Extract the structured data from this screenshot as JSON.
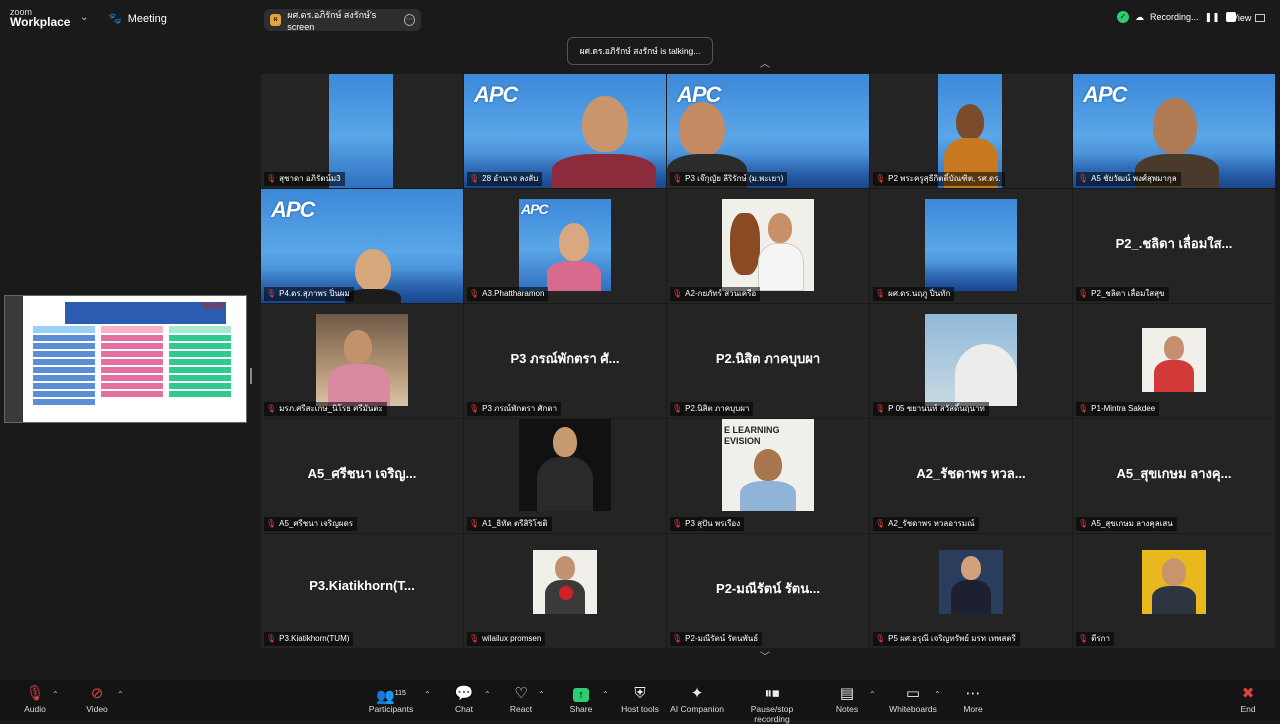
{
  "app": {
    "logo_line1": "zoom",
    "logo_line2": "Workplace",
    "meeting_label": "Meeting"
  },
  "screen_share_pill": {
    "label": "ผศ.ดร.อภิรักษ์ สงรักษ์'s screen",
    "badge": "ผ"
  },
  "recording": {
    "label": "Recording..."
  },
  "view_label": "View",
  "talking": "ผศ.ดร.อภิรักษ์ สงรักษ์ is talking...",
  "shared_screen": {
    "brand": "RUTS"
  },
  "tiles": [
    {
      "label": "สุชาดา อภิรัตน์ม3",
      "big": ""
    },
    {
      "label": "28 อำนาจ ลงลับ",
      "big": ""
    },
    {
      "label": "P3 เจ๊กุญัย ลีริรักษ์ (ม.พะเยา)",
      "big": ""
    },
    {
      "label": "P2 พระครูสุธีกิตติ์บัณฑิต, รศ.ดร.",
      "big": ""
    },
    {
      "label": "A5 ชัยวัฒน์ พงศ์สุพมากุล",
      "big": ""
    },
    {
      "label": "P4.ดร.สุภาพร ปิ่นผม",
      "big": ""
    },
    {
      "label": "A3.Phattharamon",
      "big": ""
    },
    {
      "label": "A2-กยภัทร์ สวนเครือ",
      "big": ""
    },
    {
      "label": "ผศ.ดร.นฤภู ปิ่นทัก",
      "big": ""
    },
    {
      "label": "P2_ชลิดา เลื่อมใสสุข",
      "big": "P2_.ชลิดา เลื่อมใส..."
    },
    {
      "label": "มรภ.ศรีสะเกษ_นิโรธ ศรีมันตะ",
      "big": ""
    },
    {
      "label": "P3 ภรณ์พักตรา ศักดา",
      "big": "P3 ภรณ์พักตรา ศั..."
    },
    {
      "label": "P2.นิสิต ภาคบุบผา",
      "big": "P2.นิสิต ภาคบุบผา"
    },
    {
      "label": "P 05 ชยานนท์ สวัสดิ์นฤนาท",
      "big": ""
    },
    {
      "label": "P1-Mintra Sakdee",
      "big": ""
    },
    {
      "label": "A5_ศรีชนา เจริญผดร",
      "big": "A5_ศรีชนา เจริญ..."
    },
    {
      "label": "A1_ธิทัต ตรีสิริโชติ",
      "big": ""
    },
    {
      "label": "P3 สุปัน พรเรือง",
      "big": ""
    },
    {
      "label": "A2_รัชดาพร หวลอารมณ์",
      "big": "A2_รัชดาพร หวล..."
    },
    {
      "label": "A5_สุขเกษม ลางคุลเสน",
      "big": "A5_สุขเกษม ลางคุ..."
    },
    {
      "label": "P3.Kiatikhorn(TUM)",
      "big": "P3.Kiatikhorn(T..."
    },
    {
      "label": "wilailux promsen",
      "big": ""
    },
    {
      "label": "P2-มณีรัตน์ รัตนพันธ์",
      "big": "P2-มณีรัตน์ รัตน..."
    },
    {
      "label": "P5 ผศ.อรุณี เจริญทรัพย์ มรท เทพสตรี",
      "big": ""
    },
    {
      "label": "ตีรกา",
      "big": ""
    }
  ],
  "toolbar": {
    "audio": "Audio",
    "video": "Video",
    "participants": "Participants",
    "participants_count": "115",
    "chat": "Chat",
    "react": "React",
    "share": "Share",
    "host_tools": "Host tools",
    "ai_companion": "AI Companion",
    "pause_recording": "Pause/stop recording",
    "notes": "Notes",
    "whiteboards": "Whiteboards",
    "more": "More",
    "end": "End"
  },
  "icons": [
    "mic-muted-icon",
    "video-off-icon",
    "participants-icon",
    "chat-icon",
    "react-icon",
    "share-icon",
    "shield-icon",
    "sparkle-icon",
    "pause-icon",
    "notes-icon",
    "whiteboard-icon",
    "more-icon",
    "end-icon"
  ]
}
